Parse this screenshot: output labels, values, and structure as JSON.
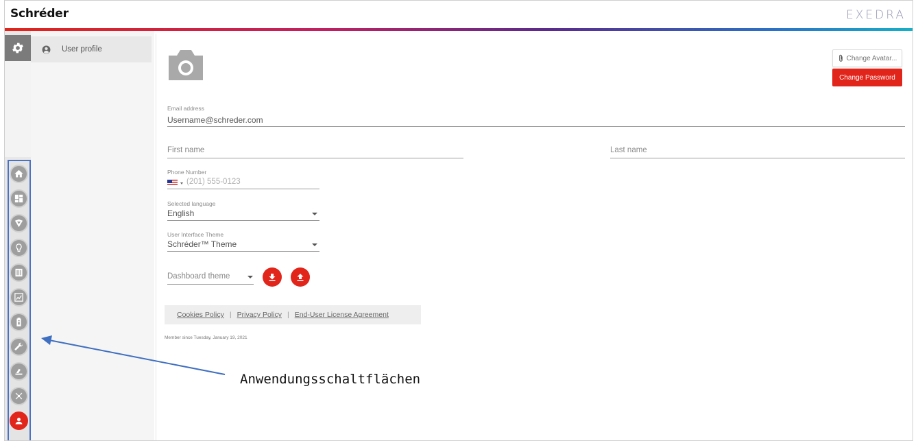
{
  "header": {
    "brand": "Schréder",
    "product": "EXEDRA"
  },
  "submenu": {
    "items": [
      {
        "label": "User profile"
      }
    ]
  },
  "profile": {
    "change_avatar_label": "Change Avatar...",
    "change_password_label": "Change Password",
    "email": {
      "label": "Email address",
      "value": "Username@schreder.com"
    },
    "first_name": {
      "placeholder": "First name"
    },
    "last_name": {
      "placeholder": "Last name"
    },
    "phone": {
      "label": "Phone Number",
      "placeholder": "(201) 555-0123"
    },
    "language": {
      "label": "Selected language",
      "value": "English"
    },
    "theme": {
      "label": "User Interface Theme",
      "value": "Schréder™ Theme"
    },
    "dashboard_theme": {
      "placeholder": "Dashboard theme"
    },
    "links": {
      "cookies": "Cookies Policy",
      "privacy": "Privacy Policy",
      "eula": "End-User License Agreement",
      "separator": "|"
    },
    "member_since": "Member since Tuesday, January 19, 2021"
  },
  "annotation": {
    "text": "Anwendungsschaltflächen"
  },
  "colors": {
    "accent": "#e1251b",
    "rail_highlight": "#4a72c4",
    "rail_icon": "#9e9e9e"
  },
  "app_buttons": [
    {
      "icon": "home-icon"
    },
    {
      "icon": "dashboard-icon"
    },
    {
      "icon": "shield-icon"
    },
    {
      "icon": "lightbulb-icon"
    },
    {
      "icon": "catalog-icon"
    },
    {
      "icon": "chart-icon"
    },
    {
      "icon": "battery-icon"
    },
    {
      "icon": "wrench-icon"
    },
    {
      "icon": "lift-icon"
    },
    {
      "icon": "satellite-icon"
    },
    {
      "icon": "user-icon"
    }
  ]
}
